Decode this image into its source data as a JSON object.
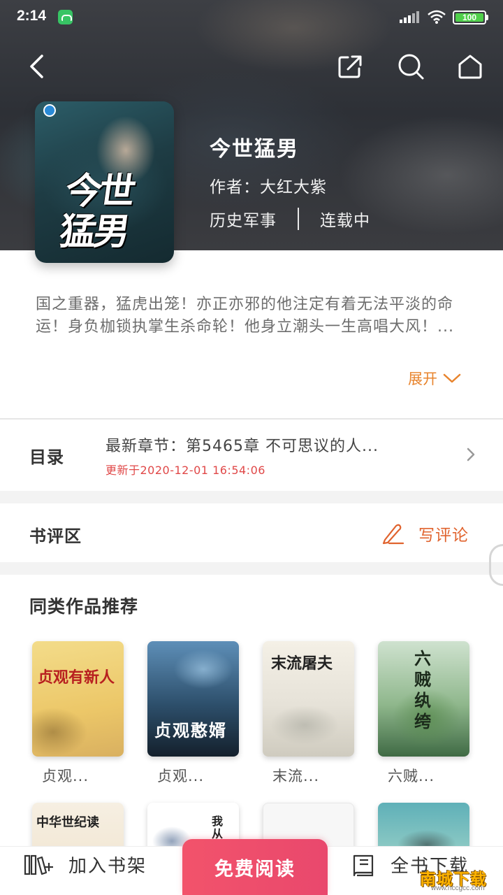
{
  "status_bar": {
    "time": "2:14",
    "battery": "100"
  },
  "nav": {
    "back_icon": "chevron-left-icon",
    "share_icon": "share-icon",
    "search_icon": "search-icon",
    "home_icon": "home-icon"
  },
  "book": {
    "cover_text": "今世猛男",
    "title": "今世猛男",
    "author": "作者：大红大紫",
    "category": "历史军事",
    "status": "连载中",
    "intro": "国之重器，猛虎出笼！亦正亦邪的他注定有着无法平淡的命运！身负枷锁执掌生杀命轮！他身立潮头一生高唱大风！...",
    "expand_label": "展开"
  },
  "catalog": {
    "label": "目录",
    "latest": "最新章节：第5465章 不可思议的人...",
    "updated": "更新于2020-12-01 16:54:06"
  },
  "review": {
    "label": "书评区",
    "write_label": "写评论"
  },
  "recommend": {
    "title": "同类作品推荐",
    "items": [
      {
        "label": "贞观...",
        "cover_text": "贞观有新人"
      },
      {
        "label": "贞观...",
        "cover_text": "贞观憨婿"
      },
      {
        "label": "末流...",
        "cover_text": "末流屠夫"
      },
      {
        "label": "六贼...",
        "cover_text": "六贼纨绔"
      }
    ],
    "row2": [
      {
        "cover_text": "中华世纪读"
      },
      {
        "cover_text": "我从"
      },
      {
        "cover_text": ""
      },
      {
        "cover_text": ""
      }
    ]
  },
  "bottom_bar": {
    "add_shelf": "加入书架",
    "read": "免费阅读",
    "download": "全书下载"
  },
  "watermark": {
    "main": "南城下载",
    "sub": "www.nccgcc.com"
  },
  "colors": {
    "accent_orange": "#e8842d",
    "read_button": "#ef4f6c",
    "update_red": "#e04848"
  }
}
